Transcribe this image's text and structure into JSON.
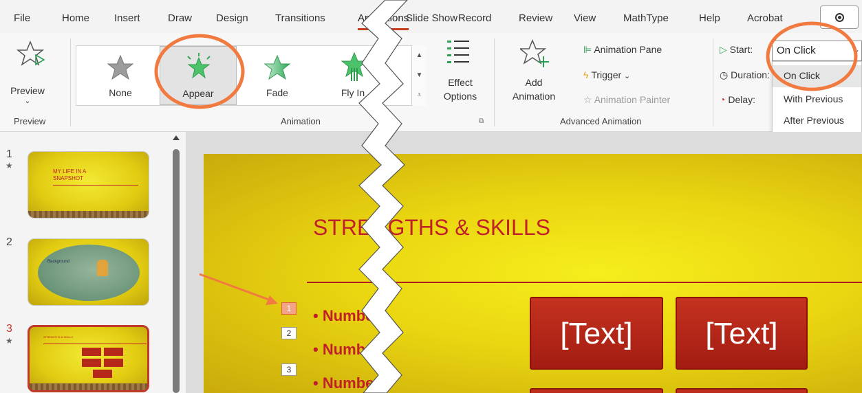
{
  "menu": {
    "tabs": [
      "File",
      "Home",
      "Insert",
      "Draw",
      "Design",
      "Transitions",
      "Animations",
      "Slide Show",
      "Record",
      "Review",
      "View",
      "MathType",
      "Help",
      "Acrobat"
    ]
  },
  "ribbon": {
    "preview": {
      "button_label": "Preview",
      "group_label": "Preview"
    },
    "animation": {
      "items": [
        "None",
        "Appear",
        "Fade",
        "Fly In"
      ],
      "selected": "Appear",
      "effect_options_line1": "Effect",
      "effect_options_line2": "Options",
      "group_label": "Animation"
    },
    "advanced": {
      "add_line1": "Add",
      "add_line2": "Animation",
      "animation_pane": "Animation Pane",
      "trigger": "Trigger",
      "animation_painter": "Animation Painter",
      "group_label": "Advanced Animation"
    },
    "timing": {
      "start_label": "Start:",
      "duration_label": "Duration:",
      "delay_label": "Delay:",
      "start_value": "On Click",
      "options": [
        "On Click",
        "With Previous",
        "After Previous"
      ]
    }
  },
  "thumbnails": [
    {
      "number": "1",
      "title_lines": [
        "MY LIFE IN A",
        "SNAPSHOT"
      ]
    },
    {
      "number": "2",
      "title_lines": [
        "Background"
      ]
    },
    {
      "number": "3",
      "title_lines": [
        "STRENGTHS & SKILLS"
      ]
    }
  ],
  "slide": {
    "title": "STRENGTHS & SKILLS",
    "bullets": [
      "Number",
      "Number",
      "Number"
    ],
    "anim_tags": [
      "1",
      "2",
      "3"
    ],
    "text_boxes": [
      "[Text]",
      "[Text]"
    ]
  },
  "colors": {
    "annotation": "#f07a40",
    "slide_red": "#c0202a",
    "slide_yellow": "#ede019"
  }
}
